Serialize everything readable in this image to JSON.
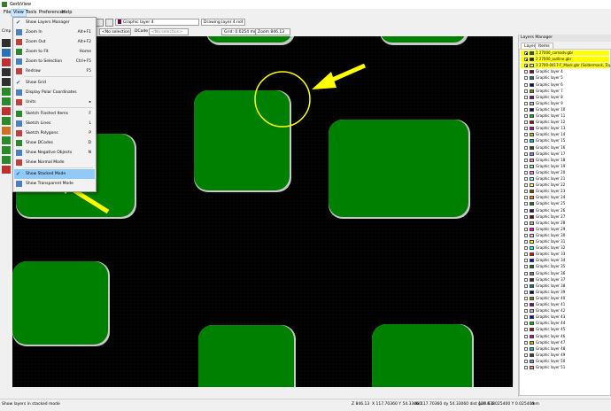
{
  "window": {
    "title": "GerbView"
  },
  "menubar": [
    "File",
    "View",
    "Tools",
    "Preferences",
    "Help"
  ],
  "toolbar": {
    "layer_combo": "Graphic layer 4",
    "drawing_status": "Drawing layer 4 not in use",
    "component_label": "Cmp",
    "net_combo": "<No selection>",
    "dcode_label": "DCode",
    "dcode_combo": "<No selection>",
    "grid_combo": "Grid: 0.0254 mm (1.00 mils)",
    "zoom_combo": "Zoom 846.13"
  },
  "view_menu": {
    "items": [
      {
        "label": "Show Layers Manager",
        "shortcut": "",
        "icon": "check-icon"
      },
      {
        "label": "Zoom In",
        "shortcut": "Alt+F1",
        "icon": "zoom-in-icon"
      },
      {
        "label": "Zoom Out",
        "shortcut": "Alt+F2",
        "icon": "zoom-out-icon"
      },
      {
        "label": "Zoom to Fit",
        "shortcut": "Home",
        "icon": "zoom-fit-icon"
      },
      {
        "label": "Zoom to Selection",
        "shortcut": "Ctrl+F5",
        "icon": "zoom-selection-icon"
      },
      {
        "label": "Redraw",
        "shortcut": "F5",
        "icon": "redraw-icon"
      },
      {
        "label": "Show Grid",
        "shortcut": "",
        "icon": "grid-check-icon"
      },
      {
        "label": "Display Polar Coordinates",
        "shortcut": "",
        "icon": "polar-icon"
      },
      {
        "label": "Units",
        "shortcut": "",
        "icon": "units-icon"
      },
      {
        "label": "Sketch Flashed Items",
        "shortcut": "F",
        "icon": "sketch-flashed-icon"
      },
      {
        "label": "Sketch Lines",
        "shortcut": "L",
        "icon": "sketch-lines-icon"
      },
      {
        "label": "Sketch Polygons",
        "shortcut": "P",
        "icon": "sketch-polygons-icon"
      },
      {
        "label": "Show DCodes",
        "shortcut": "D",
        "icon": "dcodes-icon"
      },
      {
        "label": "Show Negative Objects",
        "shortcut": "N",
        "icon": "negative-icon"
      },
      {
        "label": "Show Normal Mode",
        "shortcut": "",
        "icon": "normal-mode-icon"
      },
      {
        "label": "Show Stacked Mode",
        "shortcut": "",
        "icon": "stacked-check-icon"
      },
      {
        "label": "Show Transparent Mode",
        "shortcut": "",
        "icon": "transparent-mode-icon"
      }
    ]
  },
  "layers_manager": {
    "title": "Layers Manager",
    "tabs": [
      "Layers",
      "Items"
    ],
    "layers": [
      {
        "name": "1 27000_comadv.gbr",
        "color": "#008000",
        "checked": true,
        "highlight": true
      },
      {
        "name": "2 27000_outline.gbr",
        "color": "#202020",
        "checked": true,
        "highlight": true
      },
      {
        "name": "3 2700-0417-F_Mask.gbr (Soldermask, Top)",
        "color": "#e0e0e0",
        "checked": true,
        "highlight": true
      },
      {
        "name": "Graphic layer 4",
        "color": "#800040",
        "checked": false
      },
      {
        "name": "Graphic layer 5",
        "color": "#008080",
        "checked": false
      },
      {
        "name": "Graphic layer 6",
        "color": "#000080",
        "checked": false
      },
      {
        "name": "Graphic layer 7",
        "color": "#808000",
        "checked": false
      },
      {
        "name": "Graphic layer 8",
        "color": "#800080",
        "checked": false
      },
      {
        "name": "Graphic layer 9",
        "color": "#c0c0c0",
        "checked": false
      },
      {
        "name": "Graphic layer 10",
        "color": "#0000c0",
        "checked": false
      },
      {
        "name": "Graphic layer 11",
        "color": "#00c000",
        "checked": false
      },
      {
        "name": "Graphic layer 12",
        "color": "#c00000",
        "checked": false
      },
      {
        "name": "Graphic layer 13",
        "color": "#c000c0",
        "checked": false
      },
      {
        "name": "Graphic layer 14",
        "color": "#c0c000",
        "checked": false
      },
      {
        "name": "Graphic layer 15",
        "color": "#00c0c0",
        "checked": false
      },
      {
        "name": "Graphic layer 16",
        "color": "#404040",
        "checked": false
      },
      {
        "name": "Graphic layer 17",
        "color": "#8080ff",
        "checked": false
      },
      {
        "name": "Graphic layer 18",
        "color": "#ff8080",
        "checked": false
      },
      {
        "name": "Graphic layer 19",
        "color": "#80ff80",
        "checked": false
      },
      {
        "name": "Graphic layer 20",
        "color": "#ff80ff",
        "checked": false
      },
      {
        "name": "Graphic layer 21",
        "color": "#80ffff",
        "checked": false
      },
      {
        "name": "Graphic layer 22",
        "color": "#ffff80",
        "checked": false
      },
      {
        "name": "Graphic layer 23",
        "color": "#804000",
        "checked": false
      },
      {
        "name": "Graphic layer 24",
        "color": "#ff8000",
        "checked": false
      },
      {
        "name": "Graphic layer 25",
        "color": "#008040",
        "checked": false
      },
      {
        "name": "Graphic layer 26",
        "color": "#400080",
        "checked": false
      },
      {
        "name": "Graphic layer 27",
        "color": "#800000",
        "checked": false
      },
      {
        "name": "Graphic layer 28",
        "color": "#c0c080",
        "checked": false
      },
      {
        "name": "Graphic layer 29",
        "color": "#ff00ff",
        "checked": false
      },
      {
        "name": "Graphic layer 30",
        "color": "#ffc0c0",
        "checked": false
      },
      {
        "name": "Graphic layer 31",
        "color": "#ffff00",
        "checked": false
      },
      {
        "name": "Graphic layer 32",
        "color": "#00ffff",
        "checked": false
      },
      {
        "name": "Graphic layer 33",
        "color": "#ff0000",
        "checked": false
      },
      {
        "name": "Graphic layer 34",
        "color": "#0000ff",
        "checked": false
      },
      {
        "name": "Graphic layer 35",
        "color": "#008000",
        "checked": false
      },
      {
        "name": "Graphic layer 36",
        "color": "#808080",
        "checked": false
      },
      {
        "name": "Graphic layer 37",
        "color": "#800040",
        "checked": false
      },
      {
        "name": "Graphic layer 38",
        "color": "#008080",
        "checked": false
      },
      {
        "name": "Graphic layer 39",
        "color": "#000080",
        "checked": false
      },
      {
        "name": "Graphic layer 40",
        "color": "#808000",
        "checked": false
      },
      {
        "name": "Graphic layer 41",
        "color": "#800080",
        "checked": false
      },
      {
        "name": "Graphic layer 42",
        "color": "#c0c0c0",
        "checked": false
      },
      {
        "name": "Graphic layer 43",
        "color": "#0000c0",
        "checked": false
      },
      {
        "name": "Graphic layer 44",
        "color": "#00c000",
        "checked": false
      },
      {
        "name": "Graphic layer 45",
        "color": "#c00000",
        "checked": false
      },
      {
        "name": "Graphic layer 46",
        "color": "#c000c0",
        "checked": false
      },
      {
        "name": "Graphic layer 47",
        "color": "#c0c000",
        "checked": false
      },
      {
        "name": "Graphic layer 48",
        "color": "#00c0c0",
        "checked": false
      },
      {
        "name": "Graphic layer 49",
        "color": "#404040",
        "checked": false
      },
      {
        "name": "Graphic layer 50",
        "color": "#8080ff",
        "checked": false
      },
      {
        "name": "Graphic layer 51",
        "color": "#ff8080",
        "checked": false
      }
    ]
  },
  "status": {
    "hint": "Show layers in stacked mode",
    "zoom": "Z 846.13",
    "xy": "X 117.70360  Y 54.33060",
    "delta": "dx 117.70360  dy 54.33060  dist 129.638",
    "grid": "grid X 0.025400  Y 0.025400",
    "units": "mm"
  },
  "colors": {
    "pad": "#008000",
    "pad_edge": "#c8c8c8",
    "annotation": "#ffff00",
    "selected_menu": "#91c9f7"
  }
}
